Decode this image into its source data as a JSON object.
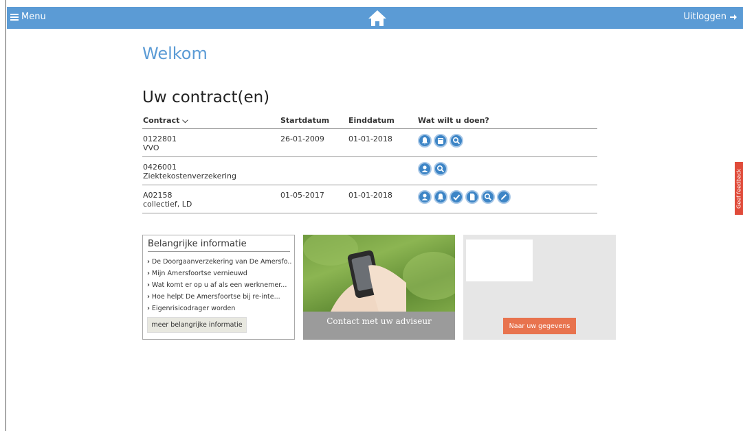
{
  "topbar": {
    "menu_label": "Menu",
    "logout_label": "Uitloggen",
    "accent": "#5b9bd5"
  },
  "welcome": "Welkom",
  "contracts": {
    "title": "Uw contract(en)",
    "headers": {
      "contract": "Contract",
      "start": "Startdatum",
      "end": "Einddatum",
      "actions": "Wat wilt u doen?"
    },
    "rows": [
      {
        "number": "0122801",
        "type": "VVO",
        "start": "26-01-2009",
        "end": "01-01-2018",
        "actions": [
          "bell-icon",
          "calendar-icon",
          "search-icon"
        ]
      },
      {
        "number": "0426001",
        "type": "Ziektekostenverzekering",
        "start": "",
        "end": "",
        "actions": [
          "user-icon",
          "search-icon"
        ]
      },
      {
        "number": "A02158",
        "type": "collectief, LD",
        "start": "01-05-2017",
        "end": "01-01-2018",
        "actions": [
          "user-icon",
          "bell-icon",
          "check-icon",
          "document-icon",
          "search-icon",
          "pencil-icon"
        ]
      }
    ]
  },
  "info": {
    "title": "Belangrijke informatie",
    "items": [
      "De Doorgaanverzekering van De Amersfo...",
      "Mijn Amersfoortse vernieuwd",
      "Wat komt er op u af als een werknemer...",
      "Hoe helpt De Amersfoortse bij re-inte...",
      "Eigenrisicodrager worden"
    ],
    "more_label": "meer belangrijke informatie"
  },
  "advisor": {
    "caption": "Contact met uw adviseur"
  },
  "data_tile": {
    "button_label": "Naar uw gegevens",
    "button_color": "#e8734e"
  },
  "feedback": {
    "label": "Geef feedback"
  }
}
